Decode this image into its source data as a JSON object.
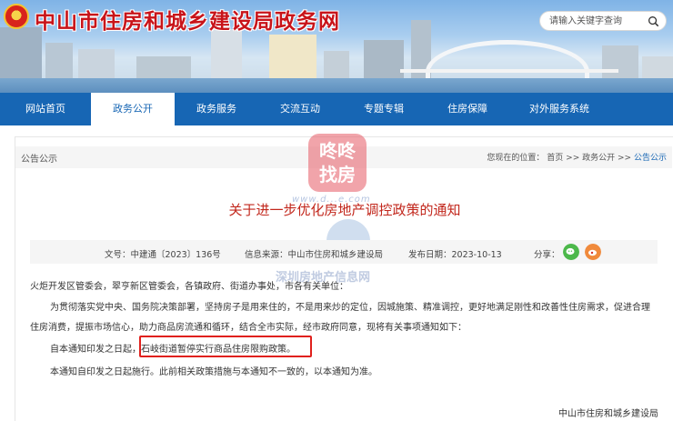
{
  "header": {
    "site_title": "中山市住房和城乡建设局政务网",
    "search_placeholder": "请输入关键字查询"
  },
  "nav": {
    "items": [
      {
        "label": "网站首页",
        "active": false
      },
      {
        "label": "政务公开",
        "active": true
      },
      {
        "label": "政务服务",
        "active": false
      },
      {
        "label": "交流互动",
        "active": false
      },
      {
        "label": "专题专辑",
        "active": false
      },
      {
        "label": "住房保障",
        "active": false
      },
      {
        "label": "对外服务系统",
        "active": false
      }
    ]
  },
  "section": {
    "name": "公告公示",
    "breadcrumb_prefix": "您现在的位置：",
    "breadcrumb": [
      "首页",
      "政务公开",
      "公告公示"
    ],
    "breadcrumb_sep": ">>"
  },
  "watermark": {
    "brand_line1": "咚咚",
    "brand_line2": "找房",
    "domain": "www.d...e.com",
    "site_text": "深圳房地产信息网"
  },
  "document": {
    "title": "关于进一步优化房地产调控政策的通知",
    "doc_no": "文号：中建通〔2023〕136号",
    "source": "信息来源：中山市住房和城乡建设局",
    "date": "发布日期：2023-10-13",
    "share_label": "分享：",
    "recipients": "火炬开发区管委会，翠亨新区管委会，各镇政府、街道办事处，市各有关单位：",
    "para1_line1": "为贯彻落实党中央、国务院决策部署，坚持房子是用来住的，不是用来炒的定位，因城施策、精准调控，更好地满足刚性和改善性住房需求，促进合理",
    "para1_line2": "住房消费，提振市场信心，助力商品房流通和循环，结合全市实际，经市政府同意，现将有关事项通知如下：",
    "para2_prefix": "自本通知印发之日起，",
    "para2_highlight": "石岐街道暂停实行商品住房限购政策。",
    "para3": "本通知自印发之日起施行。此前相关政策措施与本通知不一致的，以本通知为准。",
    "signature": "中山市住房和城乡建设局"
  },
  "colors": {
    "nav_bg": "#1766b4",
    "title_red": "#c2271c",
    "highlight_border": "#e0201c",
    "site_title_red": "#c8141a"
  }
}
